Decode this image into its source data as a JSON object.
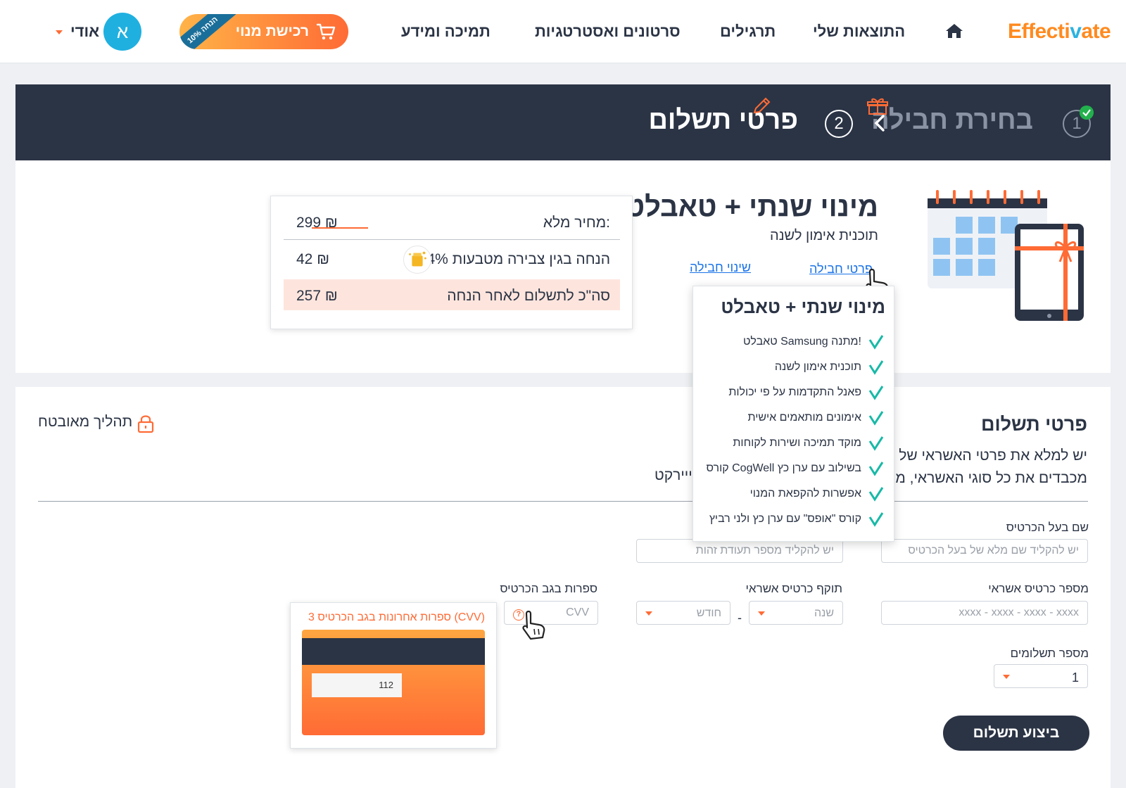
{
  "header": {
    "logo_a": "Effecti",
    "logo_b": "v",
    "logo_c": "ate",
    "nav": [
      "התוצאות שלי",
      "תרגילים",
      "סרטונים ואסטרטגיות",
      "תמיכה ומידע"
    ],
    "buy_label": "רכישת מנוי",
    "buy_ribbon": "10% הנחה",
    "user_name": "אודי",
    "avatar_letter": "א"
  },
  "steps": {
    "step1_num": "1",
    "step1_label": "בחירת חבילה",
    "step2_num": "2",
    "step2_label": "פרטי תשלום"
  },
  "product": {
    "title": "מינוי שנתי + טאבלט",
    "subtitle": "תוכנית אימון לשנה",
    "details_link": "פרטי חבילה",
    "change_link": "שינוי חבילה"
  },
  "price": {
    "full_label": "מחיר מלא:",
    "full_value": "299 ₪",
    "discount_label": "14% הנחה בגין צבירה מטבעות",
    "discount_value": "42 ₪",
    "total_label": "סה\"כ לתשלום לאחר הנחה",
    "total_value": "257 ₪"
  },
  "popup": {
    "title": "מינוי שנתי + טאבלט",
    "items": [
      "טאבלט Samsung מתנה!",
      "תוכנית אימון לשנה",
      "פאנל התקדמות על פי יכולות",
      "אימונים מותאמים אישית",
      "מוקד תמיכה ושירות לקוחות",
      "קורס CogWell בשילוב עם ערן כץ",
      "אפשרות להקפאת המנוי",
      "קורס \"אופס\" עם ערן כץ ולני רביץ"
    ]
  },
  "payment": {
    "title": "פרטי תשלום",
    "desc_line1": "יש למלא את פרטי האשראי של",
    "desc_line2": "מכבדים את כל סוגי האשראי, מ",
    "desc_tail": "ייירקט",
    "secure_label": "תהליך מאובטח",
    "holder_label": "שם בעל הכרטיס",
    "holder_placeholder": "יש להקליד שם מלא של בעל הכרטיס",
    "id_placeholder": "יש להקליד מספר תעודת זהות",
    "card_label": "מספר כרטיס אשראי",
    "card_placeholder": "xxxx - xxxx - xxxx - xxxx",
    "expiry_label": "תוקף כרטיס אשראי",
    "year_placeholder": "שנה",
    "month_placeholder": "חודש",
    "cvv_label": "ספרות בגב הכרטיס",
    "cvv_placeholder": "CVV",
    "cvv_help_title": "3 ספרות אחרונות בגב הכרטיס (CVV)",
    "cvv_example": "112",
    "installments_label": "מספר תשלומים",
    "installments_value": "1",
    "submit_label": "ביצוע תשלום",
    "dash": "-"
  },
  "colors": {
    "navy": "#2b3445",
    "orange": "#ff6b35",
    "blue": "#2bb3e0",
    "link": "#1a73e8"
  }
}
